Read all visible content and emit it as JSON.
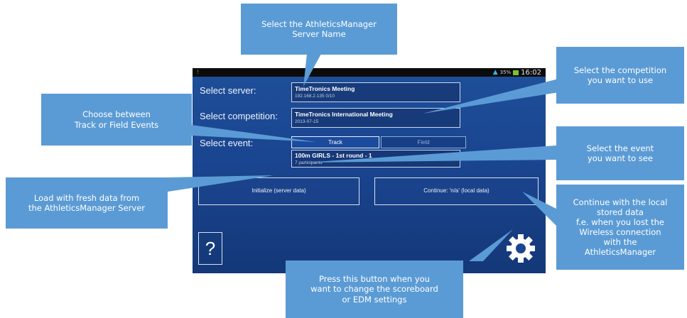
{
  "status_bar": {
    "signal": "!",
    "battery": "35%",
    "time": "16:02"
  },
  "server": {
    "label": "Select server:",
    "name": "TimeTronics Meeting",
    "detail": "192.168.2.135    0/10"
  },
  "competition": {
    "label": "Select competition:",
    "name": "TimeTronics International Meeting",
    "date": "2013-07-15"
  },
  "event": {
    "label": "Select event:",
    "tabs": [
      "Track",
      "Field"
    ],
    "selected_tab": "Track",
    "name": "100m GIRLS - 1st round - 1",
    "participants": "7 participants"
  },
  "buttons": {
    "initialize": "Initialize (server data)",
    "continue": "Continue: 'n/a' (local data)",
    "help": "?"
  },
  "icons": {
    "help": "question-mark",
    "settings": "gear-icon"
  },
  "callouts": {
    "server": "Select the AthleticsManager\nServer Name",
    "competition": "Select the competition\nyou want to use",
    "event_type": "Choose between\nTrack or Field Events",
    "event": "Select the event\nyou want to see",
    "load": "Load with fresh data from\nthe AthleticsManager Server",
    "continue": "Continue with the local\nstored data\nf.e. when you lost the\nWireless connection\nwith the\nAthleticsManager",
    "settings": "Press this button when you\nwant to change the scoreboard\nor EDM settings"
  },
  "colors": {
    "callout": "#5b9bd5",
    "screen_bg": "#1a4590"
  }
}
